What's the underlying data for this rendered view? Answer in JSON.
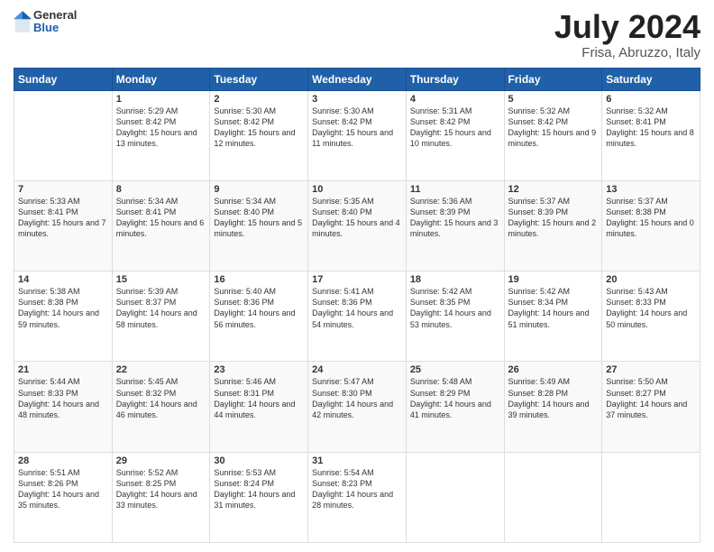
{
  "header": {
    "logo": {
      "general": "General",
      "blue": "Blue"
    },
    "title": "July 2024",
    "location": "Frisa, Abruzzo, Italy"
  },
  "calendar": {
    "weekdays": [
      "Sunday",
      "Monday",
      "Tuesday",
      "Wednesday",
      "Thursday",
      "Friday",
      "Saturday"
    ],
    "weeks": [
      [
        {
          "day": "",
          "sunrise": "",
          "sunset": "",
          "daylight": ""
        },
        {
          "day": "1",
          "sunrise": "Sunrise: 5:29 AM",
          "sunset": "Sunset: 8:42 PM",
          "daylight": "Daylight: 15 hours and 13 minutes."
        },
        {
          "day": "2",
          "sunrise": "Sunrise: 5:30 AM",
          "sunset": "Sunset: 8:42 PM",
          "daylight": "Daylight: 15 hours and 12 minutes."
        },
        {
          "day": "3",
          "sunrise": "Sunrise: 5:30 AM",
          "sunset": "Sunset: 8:42 PM",
          "daylight": "Daylight: 15 hours and 11 minutes."
        },
        {
          "day": "4",
          "sunrise": "Sunrise: 5:31 AM",
          "sunset": "Sunset: 8:42 PM",
          "daylight": "Daylight: 15 hours and 10 minutes."
        },
        {
          "day": "5",
          "sunrise": "Sunrise: 5:32 AM",
          "sunset": "Sunset: 8:42 PM",
          "daylight": "Daylight: 15 hours and 9 minutes."
        },
        {
          "day": "6",
          "sunrise": "Sunrise: 5:32 AM",
          "sunset": "Sunset: 8:41 PM",
          "daylight": "Daylight: 15 hours and 8 minutes."
        }
      ],
      [
        {
          "day": "7",
          "sunrise": "Sunrise: 5:33 AM",
          "sunset": "Sunset: 8:41 PM",
          "daylight": "Daylight: 15 hours and 7 minutes."
        },
        {
          "day": "8",
          "sunrise": "Sunrise: 5:34 AM",
          "sunset": "Sunset: 8:41 PM",
          "daylight": "Daylight: 15 hours and 6 minutes."
        },
        {
          "day": "9",
          "sunrise": "Sunrise: 5:34 AM",
          "sunset": "Sunset: 8:40 PM",
          "daylight": "Daylight: 15 hours and 5 minutes."
        },
        {
          "day": "10",
          "sunrise": "Sunrise: 5:35 AM",
          "sunset": "Sunset: 8:40 PM",
          "daylight": "Daylight: 15 hours and 4 minutes."
        },
        {
          "day": "11",
          "sunrise": "Sunrise: 5:36 AM",
          "sunset": "Sunset: 8:39 PM",
          "daylight": "Daylight: 15 hours and 3 minutes."
        },
        {
          "day": "12",
          "sunrise": "Sunrise: 5:37 AM",
          "sunset": "Sunset: 8:39 PM",
          "daylight": "Daylight: 15 hours and 2 minutes."
        },
        {
          "day": "13",
          "sunrise": "Sunrise: 5:37 AM",
          "sunset": "Sunset: 8:38 PM",
          "daylight": "Daylight: 15 hours and 0 minutes."
        }
      ],
      [
        {
          "day": "14",
          "sunrise": "Sunrise: 5:38 AM",
          "sunset": "Sunset: 8:38 PM",
          "daylight": "Daylight: 14 hours and 59 minutes."
        },
        {
          "day": "15",
          "sunrise": "Sunrise: 5:39 AM",
          "sunset": "Sunset: 8:37 PM",
          "daylight": "Daylight: 14 hours and 58 minutes."
        },
        {
          "day": "16",
          "sunrise": "Sunrise: 5:40 AM",
          "sunset": "Sunset: 8:36 PM",
          "daylight": "Daylight: 14 hours and 56 minutes."
        },
        {
          "day": "17",
          "sunrise": "Sunrise: 5:41 AM",
          "sunset": "Sunset: 8:36 PM",
          "daylight": "Daylight: 14 hours and 54 minutes."
        },
        {
          "day": "18",
          "sunrise": "Sunrise: 5:42 AM",
          "sunset": "Sunset: 8:35 PM",
          "daylight": "Daylight: 14 hours and 53 minutes."
        },
        {
          "day": "19",
          "sunrise": "Sunrise: 5:42 AM",
          "sunset": "Sunset: 8:34 PM",
          "daylight": "Daylight: 14 hours and 51 minutes."
        },
        {
          "day": "20",
          "sunrise": "Sunrise: 5:43 AM",
          "sunset": "Sunset: 8:33 PM",
          "daylight": "Daylight: 14 hours and 50 minutes."
        }
      ],
      [
        {
          "day": "21",
          "sunrise": "Sunrise: 5:44 AM",
          "sunset": "Sunset: 8:33 PM",
          "daylight": "Daylight: 14 hours and 48 minutes."
        },
        {
          "day": "22",
          "sunrise": "Sunrise: 5:45 AM",
          "sunset": "Sunset: 8:32 PM",
          "daylight": "Daylight: 14 hours and 46 minutes."
        },
        {
          "day": "23",
          "sunrise": "Sunrise: 5:46 AM",
          "sunset": "Sunset: 8:31 PM",
          "daylight": "Daylight: 14 hours and 44 minutes."
        },
        {
          "day": "24",
          "sunrise": "Sunrise: 5:47 AM",
          "sunset": "Sunset: 8:30 PM",
          "daylight": "Daylight: 14 hours and 42 minutes."
        },
        {
          "day": "25",
          "sunrise": "Sunrise: 5:48 AM",
          "sunset": "Sunset: 8:29 PM",
          "daylight": "Daylight: 14 hours and 41 minutes."
        },
        {
          "day": "26",
          "sunrise": "Sunrise: 5:49 AM",
          "sunset": "Sunset: 8:28 PM",
          "daylight": "Daylight: 14 hours and 39 minutes."
        },
        {
          "day": "27",
          "sunrise": "Sunrise: 5:50 AM",
          "sunset": "Sunset: 8:27 PM",
          "daylight": "Daylight: 14 hours and 37 minutes."
        }
      ],
      [
        {
          "day": "28",
          "sunrise": "Sunrise: 5:51 AM",
          "sunset": "Sunset: 8:26 PM",
          "daylight": "Daylight: 14 hours and 35 minutes."
        },
        {
          "day": "29",
          "sunrise": "Sunrise: 5:52 AM",
          "sunset": "Sunset: 8:25 PM",
          "daylight": "Daylight: 14 hours and 33 minutes."
        },
        {
          "day": "30",
          "sunrise": "Sunrise: 5:53 AM",
          "sunset": "Sunset: 8:24 PM",
          "daylight": "Daylight: 14 hours and 31 minutes."
        },
        {
          "day": "31",
          "sunrise": "Sunrise: 5:54 AM",
          "sunset": "Sunset: 8:23 PM",
          "daylight": "Daylight: 14 hours and 28 minutes."
        },
        {
          "day": "",
          "sunrise": "",
          "sunset": "",
          "daylight": ""
        },
        {
          "day": "",
          "sunrise": "",
          "sunset": "",
          "daylight": ""
        },
        {
          "day": "",
          "sunrise": "",
          "sunset": "",
          "daylight": ""
        }
      ]
    ]
  }
}
